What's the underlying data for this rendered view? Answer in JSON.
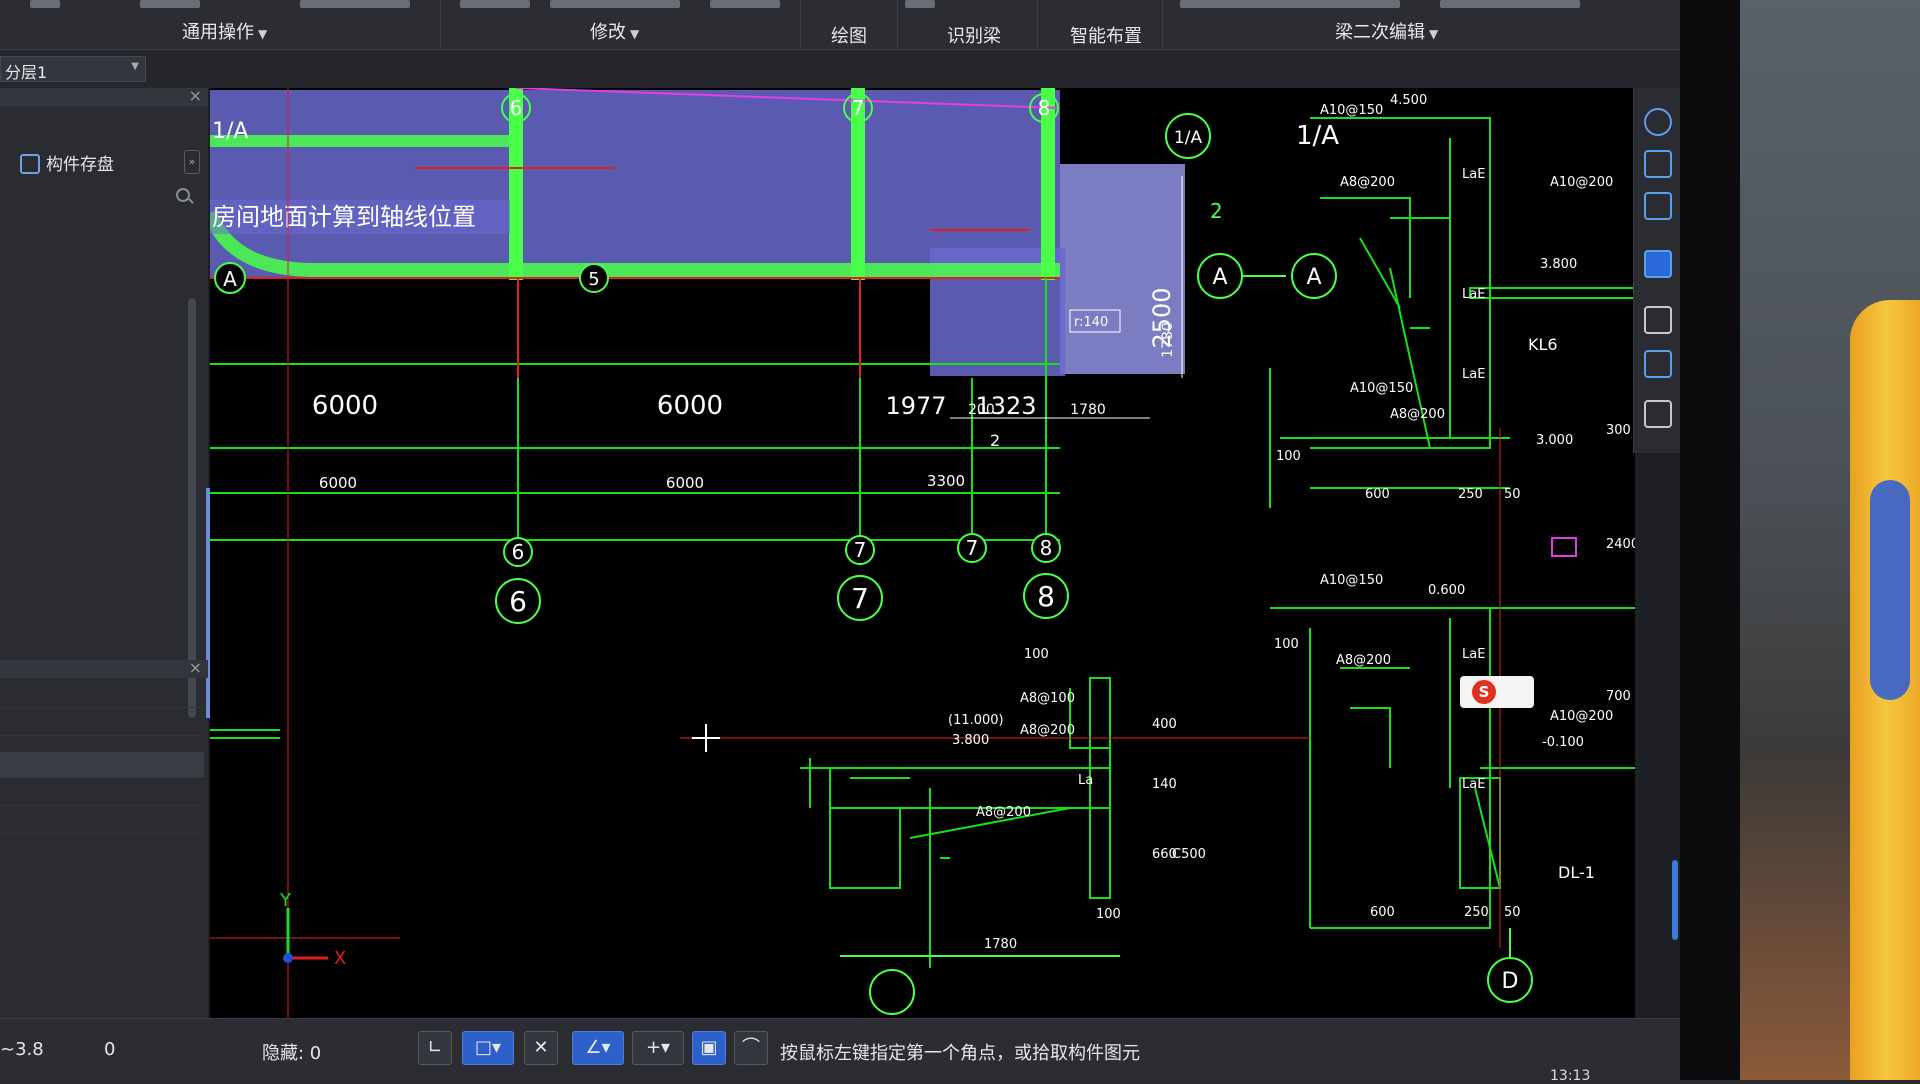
{
  "ribbon": {
    "groups": [
      {
        "label": "通用操作",
        "has_dropdown": true
      },
      {
        "label": "修改",
        "has_dropdown": true
      },
      {
        "label": "绘图",
        "has_dropdown": false
      },
      {
        "label": "识别梁",
        "has_dropdown": false
      },
      {
        "label": "智能布置",
        "has_dropdown": false
      },
      {
        "label": "梁二次编辑",
        "has_dropdown": true
      }
    ]
  },
  "layer": {
    "selected": "分层1"
  },
  "left_panel": {
    "storage_label": "构件存盘",
    "expand_glyph": "»",
    "close_glyph": "×"
  },
  "canvas": {
    "annotation": "房间地面计算到轴线位置",
    "axis_x_label": "X",
    "axis_y_label": "Y",
    "colors": {
      "grid_line": "#18e018",
      "highlight_fill": "#6a6ad0",
      "magenta": "#e040e0",
      "red": "#e02020",
      "background": "#000000"
    },
    "top_axes": [
      "6",
      "7",
      "8"
    ],
    "top_row_labels": [
      "1/A",
      "A",
      "5"
    ],
    "bottom_axes": [
      "6",
      "7",
      "7",
      "8"
    ],
    "bottom_axes_big": [
      "6",
      "7",
      "8"
    ],
    "dim_big": [
      "6000",
      "6000",
      "1977",
      "1323"
    ],
    "dim_small": [
      "6000",
      "6000",
      "3300"
    ],
    "dim_misc": [
      "1780",
      "2500",
      "1780",
      "2",
      "2",
      "200",
      "r:140"
    ],
    "section_labels": [
      "1/A",
      "A",
      "A",
      "1/A"
    ],
    "rebar_top_right": [
      "A10@150",
      "4.500",
      "A8@200",
      "A10@200",
      "3.800",
      "KL6",
      "A10@150",
      "A8@200",
      "3.000",
      "600",
      "250",
      "50",
      "100",
      "300",
      "LaE",
      "LaE",
      "LaE"
    ],
    "rebar_mid_right": [
      "A10@150",
      "0.600",
      "A8@200",
      "A10@200",
      "-0.100",
      "DL-1",
      "600",
      "250",
      "50",
      "100",
      "700",
      "2400",
      "LaE",
      "LaE"
    ],
    "rebar_bottom_center": [
      "100",
      "A8@100",
      "A8@200",
      "(11.000)",
      "3.800",
      "A8@200",
      "1780",
      "100",
      "400",
      "140",
      "660",
      "C500",
      "La"
    ],
    "axis_D": "D"
  },
  "status": {
    "coord_z": "~3.8",
    "coord_val": "0",
    "hidden_label": "隐藏: 0",
    "prompt": "按鼠标左键指定第一个角点，或拾取构件图元",
    "clock": "13:13"
  },
  "ime_badge": "S"
}
